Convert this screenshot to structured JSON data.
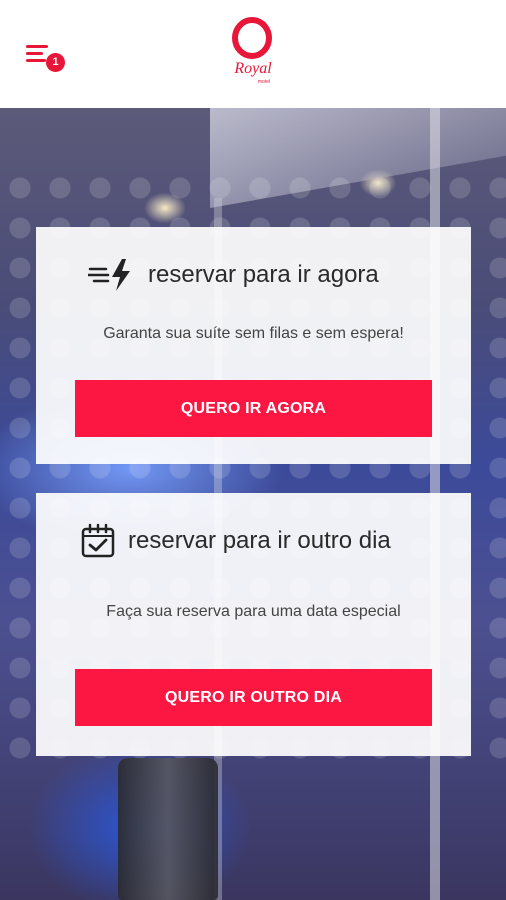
{
  "header": {
    "notification_count": "1",
    "logo_text": "Royal",
    "logo_subtext": "motel"
  },
  "cards": [
    {
      "icon": "fast-lightning-icon",
      "title": "reservar para ir agora",
      "description": "Garanta sua suíte sem filas e sem espera!",
      "button_label": "QUERO IR AGORA"
    },
    {
      "icon": "calendar-check-icon",
      "title": "reservar para ir outro dia",
      "description": "Faça sua reserva para uma data especial",
      "button_label": "QUERO IR OUTRO DIA"
    }
  ],
  "colors": {
    "accent": "#fc1743",
    "logo_red": "#e8173a"
  }
}
